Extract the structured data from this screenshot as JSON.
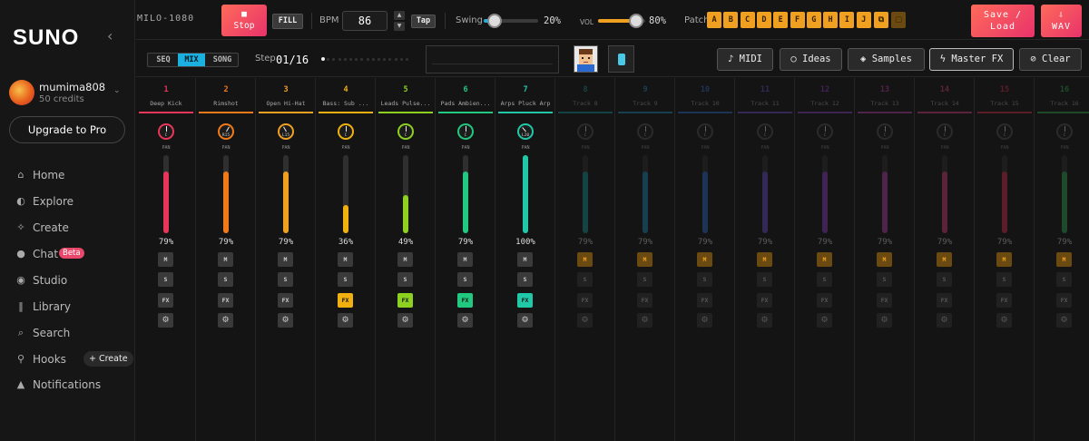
{
  "sidebar": {
    "logo": "SUNO",
    "user": {
      "name": "mumima808",
      "credits": "50 credits"
    },
    "upgrade": "Upgrade to Pro",
    "nav": [
      {
        "label": "Home",
        "icon": "home-icon"
      },
      {
        "label": "Explore",
        "icon": "compass-icon"
      },
      {
        "label": "Create",
        "icon": "sparkle-icon"
      },
      {
        "label": "Chat",
        "icon": "chat-bubble-icon",
        "badge": "Beta"
      },
      {
        "label": "Studio",
        "icon": "studio-icon"
      },
      {
        "label": "Library",
        "icon": "library-icon"
      },
      {
        "label": "Search",
        "icon": "search-icon"
      },
      {
        "label": "Hooks",
        "icon": "hook-icon",
        "action": "+ Create"
      },
      {
        "label": "Notifications",
        "icon": "bell-icon"
      }
    ]
  },
  "toolbar": {
    "device": "MILO-1080",
    "stop": "Stop",
    "fill": "FILL",
    "bpm_label": "BPM",
    "bpm": "86",
    "tap": "Tap",
    "swing_label": "Swing",
    "swing_pct": "20%",
    "swing": 0.2,
    "vol_label": "VOL",
    "vol_pct": "80%",
    "vol": 0.8,
    "patch_label": "Patch",
    "patches": [
      "A",
      "B",
      "C",
      "D",
      "E",
      "F",
      "G",
      "H",
      "I",
      "J"
    ],
    "save": "Save / Load",
    "wav": "WAV",
    "wav_icon": "download-icon"
  },
  "subbar": {
    "modes": [
      "SEQ",
      "MIX",
      "SONG"
    ],
    "active_mode": "MIX",
    "step_label": "Step",
    "step": "01/16",
    "buttons": [
      {
        "label": "MIDI",
        "icon": "♪"
      },
      {
        "label": "Ideas",
        "icon": "○"
      },
      {
        "label": "Samples",
        "icon": "◈"
      },
      {
        "label": "Master FX",
        "icon": "ϟ"
      },
      {
        "label": "Clear",
        "icon": "⊘"
      }
    ]
  },
  "colors": {
    "accent": "#f08a1a",
    "patch": "#f0a020"
  },
  "tracks": [
    {
      "num": "1",
      "name": "Deep Kick",
      "color": "#e8365a",
      "pan": "C",
      "level": 0.79,
      "vol": "79%",
      "fx": false,
      "active": true
    },
    {
      "num": "2",
      "name": "Rimshot",
      "color": "#f07a1a",
      "pan": "R15",
      "level": 0.79,
      "vol": "79%",
      "fx": false,
      "active": true
    },
    {
      "num": "3",
      "name": "Open Hi-Hat",
      "color": "#f0a020",
      "pan": "L15",
      "level": 0.79,
      "vol": "79%",
      "fx": false,
      "active": true
    },
    {
      "num": "4",
      "name": "Bass: Sub ...",
      "color": "#f0b010",
      "pan": "C",
      "level": 0.36,
      "vol": "36%",
      "fx": true,
      "active": true
    },
    {
      "num": "5",
      "name": "Leads Pulse...",
      "color": "#8ed020",
      "pan": "C",
      "level": 0.49,
      "vol": "49%",
      "fx": true,
      "active": true
    },
    {
      "num": "6",
      "name": "Pads Ambien...",
      "color": "#20c880",
      "pan": "C",
      "level": 0.79,
      "vol": "79%",
      "fx": true,
      "active": true
    },
    {
      "num": "7",
      "name": "Arps Pluck Arp",
      "color": "#20c8a8",
      "pan": "L20",
      "level": 1.0,
      "vol": "100%",
      "fx": true,
      "active": true
    },
    {
      "num": "8",
      "name": "Track 8",
      "color": "#189aa0",
      "pan": "C",
      "level": 0.79,
      "vol": "79%",
      "fx": false,
      "active": false
    },
    {
      "num": "9",
      "name": "Track 9",
      "color": "#2090c0",
      "pan": "C",
      "level": 0.79,
      "vol": "79%",
      "fx": false,
      "active": false
    },
    {
      "num": "10",
      "name": "Track 10",
      "color": "#3070d0",
      "pan": "C",
      "level": 0.79,
      "vol": "79%",
      "fx": false,
      "active": false
    },
    {
      "num": "11",
      "name": "Track 11",
      "color": "#7050d0",
      "pan": "C",
      "level": 0.79,
      "vol": "79%",
      "fx": false,
      "active": false
    },
    {
      "num": "12",
      "name": "Track 12",
      "color": "#9040c8",
      "pan": "C",
      "level": 0.79,
      "vol": "79%",
      "fx": false,
      "active": false
    },
    {
      "num": "13",
      "name": "Track 13",
      "color": "#c040b0",
      "pan": "C",
      "level": 0.79,
      "vol": "79%",
      "fx": false,
      "active": false
    },
    {
      "num": "14",
      "name": "Track 14",
      "color": "#e04080",
      "pan": "C",
      "level": 0.79,
      "vol": "79%",
      "fx": false,
      "active": false
    },
    {
      "num": "15",
      "name": "Track 15",
      "color": "#e03050",
      "pan": "C",
      "level": 0.79,
      "vol": "79%",
      "fx": false,
      "active": false
    },
    {
      "num": "16",
      "name": "Track 16",
      "color": "#30b050",
      "pan": "C",
      "level": 0.79,
      "vol": "79%",
      "fx": false,
      "active": false
    }
  ],
  "strip_buttons": {
    "mute": "M",
    "solo": "S",
    "fx": "FX",
    "settings_icon": "gear-icon",
    "pan_label": "PAN"
  }
}
